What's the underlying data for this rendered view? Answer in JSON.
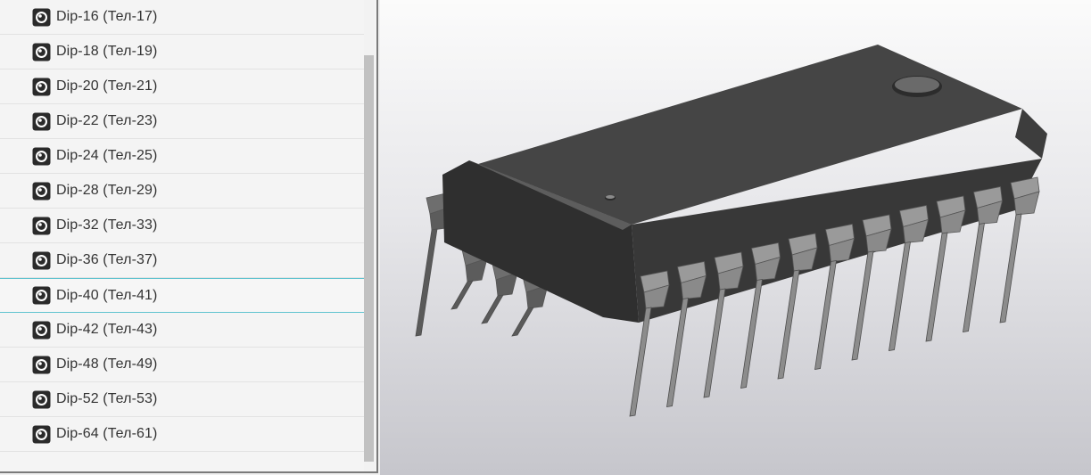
{
  "tree": {
    "items": [
      {
        "label": "Dip-16 (Тел-17)"
      },
      {
        "label": "Dip-18 (Тел-19)"
      },
      {
        "label": "Dip-20 (Тел-21)"
      },
      {
        "label": "Dip-22 (Тел-23)"
      },
      {
        "label": "Dip-24 (Тел-25)"
      },
      {
        "label": "Dip-28 (Тел-29)"
      },
      {
        "label": "Dip-32 (Тел-33)"
      },
      {
        "label": "Dip-36 (Тел-37)"
      },
      {
        "label": "Dip-40 (Тел-41)"
      },
      {
        "label": "Dip-42 (Тел-43)"
      },
      {
        "label": "Dip-48 (Тел-49)"
      },
      {
        "label": "Dip-52 (Тел-53)"
      },
      {
        "label": "Dip-64 (Тел-61)"
      }
    ],
    "selected_index": 8,
    "item_icon": "solid-body-icon"
  },
  "viewport": {
    "model": "dip-chip-3d-model",
    "colors": {
      "body_top": "#464646",
      "body_side": "#3a3a3a",
      "pins": "#8a8a8a",
      "background_top": "#fbfbfb",
      "background_bottom": "#c6c6cc"
    }
  }
}
